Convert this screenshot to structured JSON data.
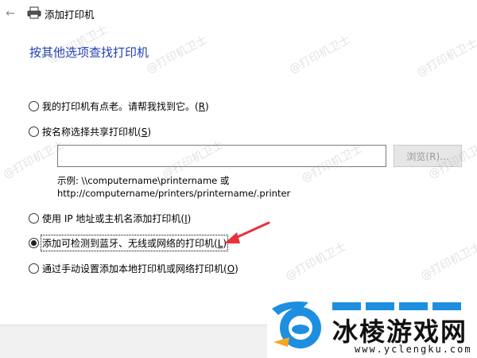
{
  "window": {
    "title": "添加打印机",
    "back_icon": "back-arrow-icon",
    "app_icon": "printer-icon"
  },
  "heading": "按其他选项查找打印机",
  "options": [
    {
      "text": "我的打印机有点老。请帮我找到它。",
      "accel": "R",
      "checked": false
    },
    {
      "text": "按名称选择共享打印机",
      "accel": "S",
      "checked": false
    },
    {
      "text": "使用 IP 地址或主机名添加打印机",
      "accel": "I",
      "checked": false
    },
    {
      "text": "添加可检测到蓝牙、无线或网络的打印机",
      "accel": "L",
      "checked": true
    },
    {
      "text": "通过手动设置添加本地打印机或网络打印机",
      "accel": "O",
      "checked": false
    }
  ],
  "shared_printer": {
    "value": "",
    "browse_label": "浏览(R)...",
    "example_line1": "示例: \\\\computername\\printername 或",
    "example_line2": "http://computername/printers/printername/.printer"
  },
  "watermark": "@打印机卫士",
  "logo": {
    "name": "冰棱游戏网",
    "url": "www.yclengku.com"
  },
  "colors": {
    "heading": "#1f3fb0",
    "arrow": "#e8323c",
    "logo_blue": "#1e8fe0"
  }
}
